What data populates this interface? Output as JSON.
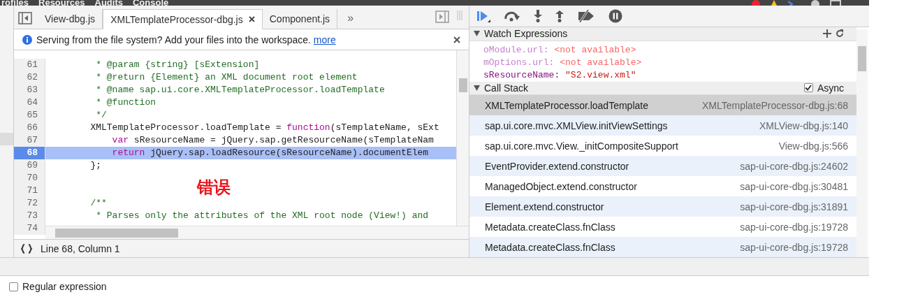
{
  "top_bar": {
    "tabs": [
      "rofiles",
      "Resources",
      "Audits",
      "Console"
    ]
  },
  "editor": {
    "tabs": [
      {
        "label": "View-dbg.js",
        "selected": false,
        "closable": false
      },
      {
        "label": "XMLTemplateProcessor-dbg.js",
        "selected": true,
        "closable": true
      },
      {
        "label": "Component.js",
        "selected": false,
        "closable": false
      }
    ],
    "more_tabs": "»",
    "infobar": {
      "message": "Serving from the file system? Add your files into the workspace.",
      "link": "more"
    },
    "lines": [
      {
        "number": "61",
        "current": false,
        "segments": [
          {
            "kind": "comment",
            "text": "         * @param {string} [sExtension]"
          }
        ]
      },
      {
        "number": "62",
        "current": false,
        "segments": [
          {
            "kind": "comment",
            "text": "         * @return {Element} an XML document root element"
          }
        ]
      },
      {
        "number": "63",
        "current": false,
        "segments": [
          {
            "kind": "comment",
            "text": "         * @name sap.ui.core.XMLTemplateProcessor.loadTemplate"
          }
        ]
      },
      {
        "number": "64",
        "current": false,
        "segments": [
          {
            "kind": "comment",
            "text": "         * @function"
          }
        ]
      },
      {
        "number": "65",
        "current": false,
        "segments": [
          {
            "kind": "comment",
            "text": "         */"
          }
        ]
      },
      {
        "number": "66",
        "current": false,
        "segments": [
          {
            "kind": "plain",
            "text": "        XMLTemplateProcessor.loadTemplate = "
          },
          {
            "kind": "keyword",
            "text": "function"
          },
          {
            "kind": "plain",
            "text": "(sTemplateName, sExt"
          }
        ]
      },
      {
        "number": "67",
        "current": false,
        "segments": [
          {
            "kind": "keyword",
            "text": "            var"
          },
          {
            "kind": "plain",
            "text": " sResourceName = jQuery.sap.getResourceName(sTemplateNam"
          }
        ]
      },
      {
        "number": "68",
        "current": true,
        "segments": [
          {
            "kind": "keyword",
            "text": "            return"
          },
          {
            "kind": "plain",
            "text": " jQuery.sap.loadResource(sResourceName).documentElem"
          }
        ]
      },
      {
        "number": "69",
        "current": false,
        "segments": [
          {
            "kind": "plain",
            "text": "        };"
          }
        ]
      },
      {
        "number": "70",
        "current": false
      },
      {
        "number": "71",
        "current": false
      },
      {
        "number": "72",
        "current": false,
        "segments": [
          {
            "kind": "comment",
            "text": "        /**"
          }
        ]
      },
      {
        "number": "73",
        "current": false,
        "segments": [
          {
            "kind": "comment",
            "text": "         * Parses only the attributes of the XML root node (View!) and"
          }
        ]
      },
      {
        "number": "74",
        "current": false
      }
    ],
    "annotation": "错误",
    "status": "Line 68, Column 1"
  },
  "debugger": {
    "watch": {
      "title": "Watch Expressions",
      "items": [
        {
          "name": "oModule.url:",
          "value": "<not available>",
          "available": false
        },
        {
          "name": "mOptions.url:",
          "value": "<not available>",
          "available": false
        },
        {
          "name": "sResourceName:",
          "value": "\"S2.view.xml\"",
          "available": true
        }
      ]
    },
    "call_stack": {
      "title": "Call Stack",
      "async_label": "Async",
      "async": true,
      "frames": [
        {
          "function": "XMLTemplateProcessor.loadTemplate",
          "location": "XMLTemplateProcessor-dbg.js:68",
          "selected": true
        },
        {
          "function": "sap.ui.core.mvc.XMLView.initViewSettings",
          "location": "XMLView-dbg.js:140",
          "selected": false
        },
        {
          "function": "sap.ui.core.mvc.View._initCompositeSupport",
          "location": "View-dbg.js:566",
          "selected": false
        },
        {
          "function": "EventProvider.extend.constructor",
          "location": "sap-ui-core-dbg.js:24602",
          "selected": false
        },
        {
          "function": "ManagedObject.extend.constructor",
          "location": "sap-ui-core-dbg.js:30481",
          "selected": false
        },
        {
          "function": "Element.extend.constructor",
          "location": "sap-ui-core-dbg.js:31891",
          "selected": false
        },
        {
          "function": "Metadata.createClass.fnClass",
          "location": "sap-ui-core-dbg.js:19728",
          "selected": false
        },
        {
          "function": "Metadata.createClass.fnClass",
          "location": "sap-ui-core-dbg.js:19728",
          "selected": false
        }
      ]
    }
  },
  "search_options": {
    "label": "Regular expression",
    "checked": false
  }
}
